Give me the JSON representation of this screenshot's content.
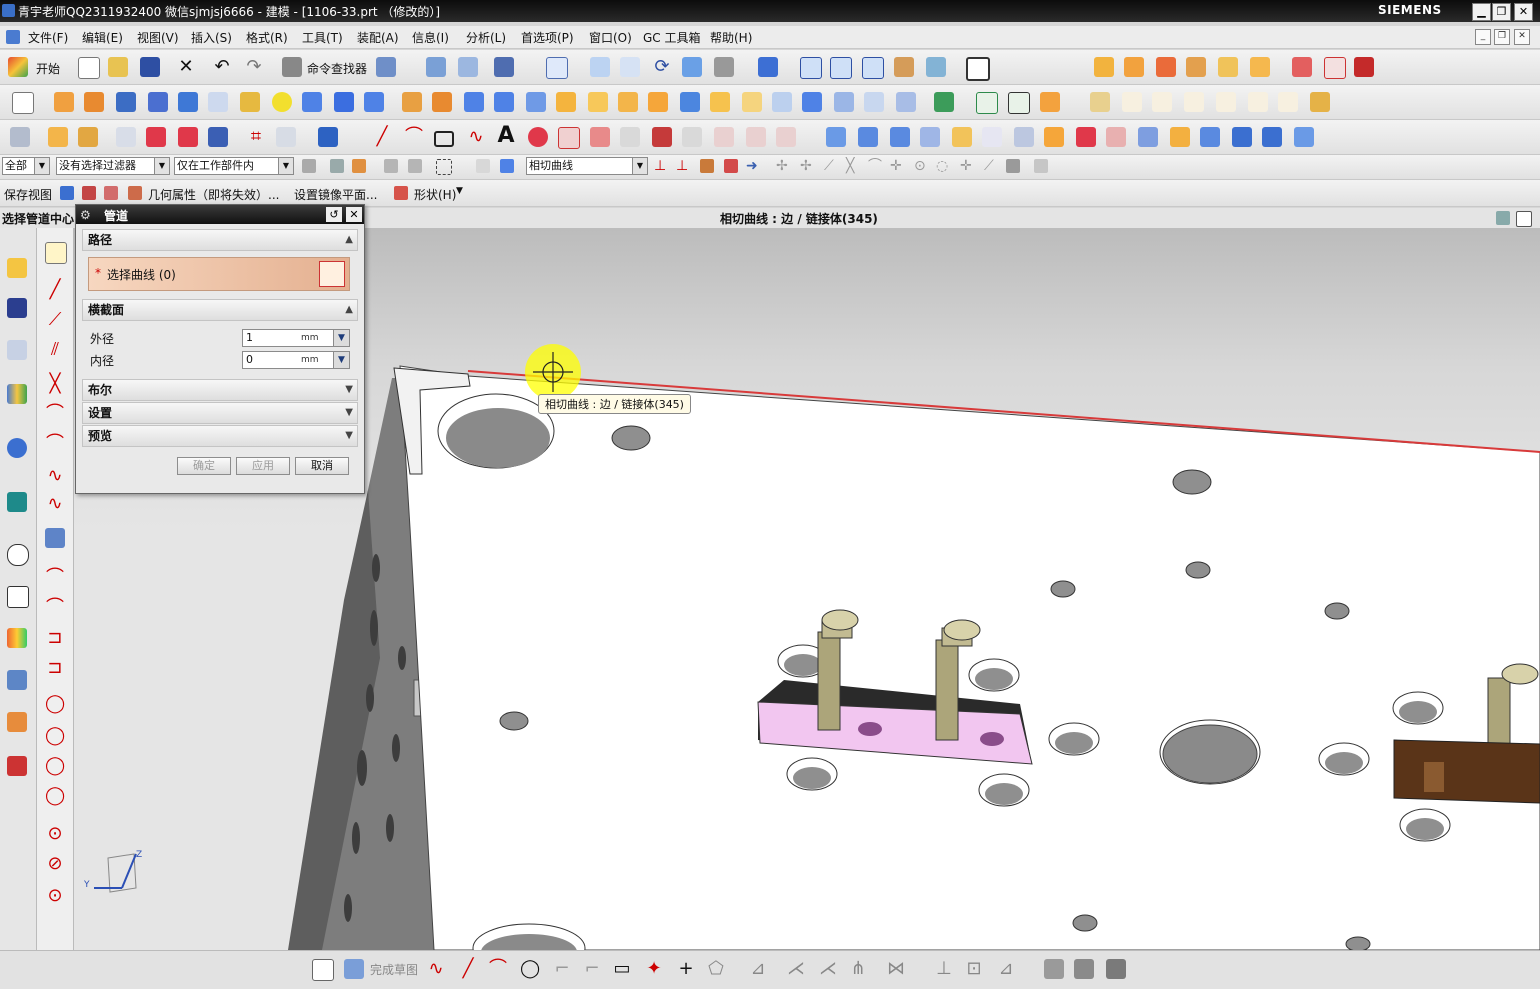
{
  "window": {
    "title": "青宇老师QQ2311932400 微信sjmjsj6666 - 建模 - [1106-33.prt （修改的）]",
    "brand": "SIEMENS",
    "minimize_label": "▁",
    "maximize_label": "❐",
    "close_label": "✕"
  },
  "menubar": {
    "items": [
      "文件(F)",
      "编辑(E)",
      "视图(V)",
      "插入(S)",
      "格式(R)",
      "工具(T)",
      "装配(A)",
      "信息(I)",
      "分析(L)",
      "首选项(P)",
      "窗口(O)",
      "GC 工具箱",
      "帮助(H)"
    ],
    "mdi_buttons": [
      "_",
      "❐",
      "✕"
    ]
  },
  "toolbar": {
    "start_label": "开始",
    "command_finder_label": "命令查找器",
    "text_tool_label": "A"
  },
  "selection_bar": {
    "filter_type": "全部",
    "selection_filter": "没有选择过滤器",
    "scope": "仅在工作部件内",
    "curve_rule": "相切曲线"
  },
  "view_bar": {
    "save_view_label": "保存视图",
    "geom_props_label": "几何属性（即将失效）...",
    "mirror_plane_label": "设置镜像平面...",
    "shape_label": "形状(H)"
  },
  "status": {
    "left_prompt": "选择管道中心",
    "center_text": "相切曲线 : 边 / 链接体(345)"
  },
  "dialog": {
    "title": "管道",
    "reset_glyph": "↺",
    "close_glyph": "✕",
    "sections": {
      "path": "路径",
      "cross_section": "横截面",
      "boolean": "布尔",
      "settings": "设置",
      "preview": "预览"
    },
    "select_curve_label": "选择曲线 (0)",
    "required_marker": "*",
    "fields": {
      "outer_diameter": {
        "label": "外径",
        "value": "1",
        "unit": "mm"
      },
      "inner_diameter": {
        "label": "内径",
        "value": "0",
        "unit": "mm"
      }
    },
    "buttons": {
      "ok": "确定",
      "apply": "应用",
      "cancel": "取消"
    }
  },
  "viewport": {
    "tooltip": "相切曲线 : 边 / 链接体(345)",
    "triad_z": "Z",
    "triad_y": "Y"
  },
  "bottom_toolbar": {
    "finish_sketch_label": "完成草图"
  },
  "colors": {
    "highlight_edge": "#d83a3a",
    "pink_part": "#f2c6f0",
    "cursor_halo": "#ffff00",
    "brown_part": "#5a3418"
  }
}
